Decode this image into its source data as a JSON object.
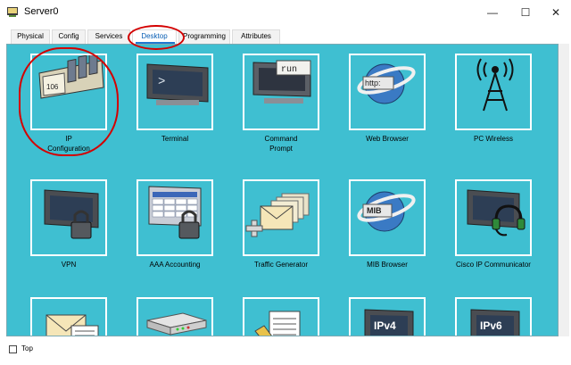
{
  "window": {
    "title": "Server0",
    "minimize_glyph": "—",
    "maximize_glyph": "☐",
    "close_glyph": "✕"
  },
  "tabs": [
    {
      "label": "Physical",
      "active": false
    },
    {
      "label": "Config",
      "active": false
    },
    {
      "label": "Services",
      "active": false
    },
    {
      "label": "Desktop",
      "active": true
    },
    {
      "label": "Programming",
      "active": false
    },
    {
      "label": "Attributes",
      "active": false
    }
  ],
  "desktop": {
    "items": [
      {
        "label": "IP\nConfiguration",
        "icon": "ip-configuration-icon",
        "icon_text": "106"
      },
      {
        "label": "Terminal",
        "icon": "terminal-icon",
        "icon_text": ">"
      },
      {
        "label": "Command\nPrompt",
        "icon": "command-prompt-icon",
        "icon_text": "run"
      },
      {
        "label": "Web Browser",
        "icon": "web-browser-icon",
        "icon_text": "http:"
      },
      {
        "label": "PC Wireless",
        "icon": "pc-wireless-icon"
      },
      {
        "label": "VPN",
        "icon": "vpn-icon"
      },
      {
        "label": "AAA Accounting",
        "icon": "aaa-accounting-icon"
      },
      {
        "label": "Traffic Generator",
        "icon": "traffic-generator-icon"
      },
      {
        "label": "MIB Browser",
        "icon": "mib-browser-icon",
        "icon_text": "MIB"
      },
      {
        "label": "Cisco IP Communicator",
        "icon": "cisco-ip-communicator-icon"
      },
      {
        "label": "",
        "icon": "email-icon"
      },
      {
        "label": "",
        "icon": "pppoe-dialer-icon"
      },
      {
        "label": "",
        "icon": "text-editor-icon"
      },
      {
        "label": "",
        "icon": "ipv4-firewall-icon",
        "icon_text": "IPv4"
      },
      {
        "label": "",
        "icon": "ipv6-firewall-icon",
        "icon_text": "IPv6"
      }
    ]
  },
  "bottom": {
    "top_label": "Top",
    "top_checked": false
  },
  "colors": {
    "desktop_bg": "#3fbfd1",
    "annotation": "#d40000",
    "active_tab": "#1f78d1"
  }
}
